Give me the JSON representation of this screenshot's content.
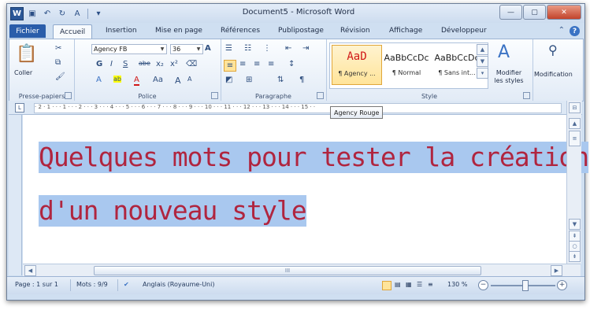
{
  "window": {
    "title": "Document5 - Microsoft Word"
  },
  "qat": {
    "icons": [
      "word-icon",
      "save-icon",
      "undo-icon",
      "redo-icon",
      "format-icon",
      "customize-icon"
    ]
  },
  "tabs": {
    "file": "Fichier",
    "items": [
      "Accueil",
      "Insertion",
      "Mise en page",
      "Références",
      "Publipostage",
      "Révision",
      "Affichage",
      "Développeur"
    ]
  },
  "ribbon": {
    "clipboard": {
      "paste": "Coller",
      "label": "Presse-papiers"
    },
    "font": {
      "name": "Agency FB",
      "size": "36",
      "label": "Police",
      "buttons": [
        "G",
        "I",
        "S",
        "abe",
        "x₂",
        "x²",
        "Aa",
        "A",
        "A"
      ]
    },
    "paragraph": {
      "label": "Paragraphe"
    },
    "styles": {
      "label": "Style",
      "items": [
        {
          "preview": "AaD",
          "name": "¶ Agency ..."
        },
        {
          "preview": "AaBbCcDc",
          "name": "¶ Normal"
        },
        {
          "preview": "AaBbCcDc",
          "name": "¶ Sans int..."
        }
      ],
      "modify": "Modifier les styles",
      "tooltip": "Agency Rouge"
    },
    "editing": {
      "label": "Modification"
    }
  },
  "ruler": {
    "text": "· 2 · 1 · · · 1 · · · 2 · · · 3 · · · 4 · · · 5 · · · 6 · · · 7 · · · 8 · · · 9 · · · 10 · · · 11 · · · 12 · · · 13 · · · 14 · · · 15 · ·"
  },
  "document": {
    "lines": [
      "Quelques mots pour tester la création",
      "d'un nouveau style"
    ]
  },
  "scroll": {
    "thumb": "III"
  },
  "status": {
    "page": "Page : 1 sur 1",
    "words": "Mots : 9/9",
    "language": "Anglais (Royaume-Uni)",
    "zoom": "130 %"
  },
  "colors": {
    "text": "#b0253f",
    "highlight": "#a9c8ef",
    "accent": "#2a5daa"
  }
}
